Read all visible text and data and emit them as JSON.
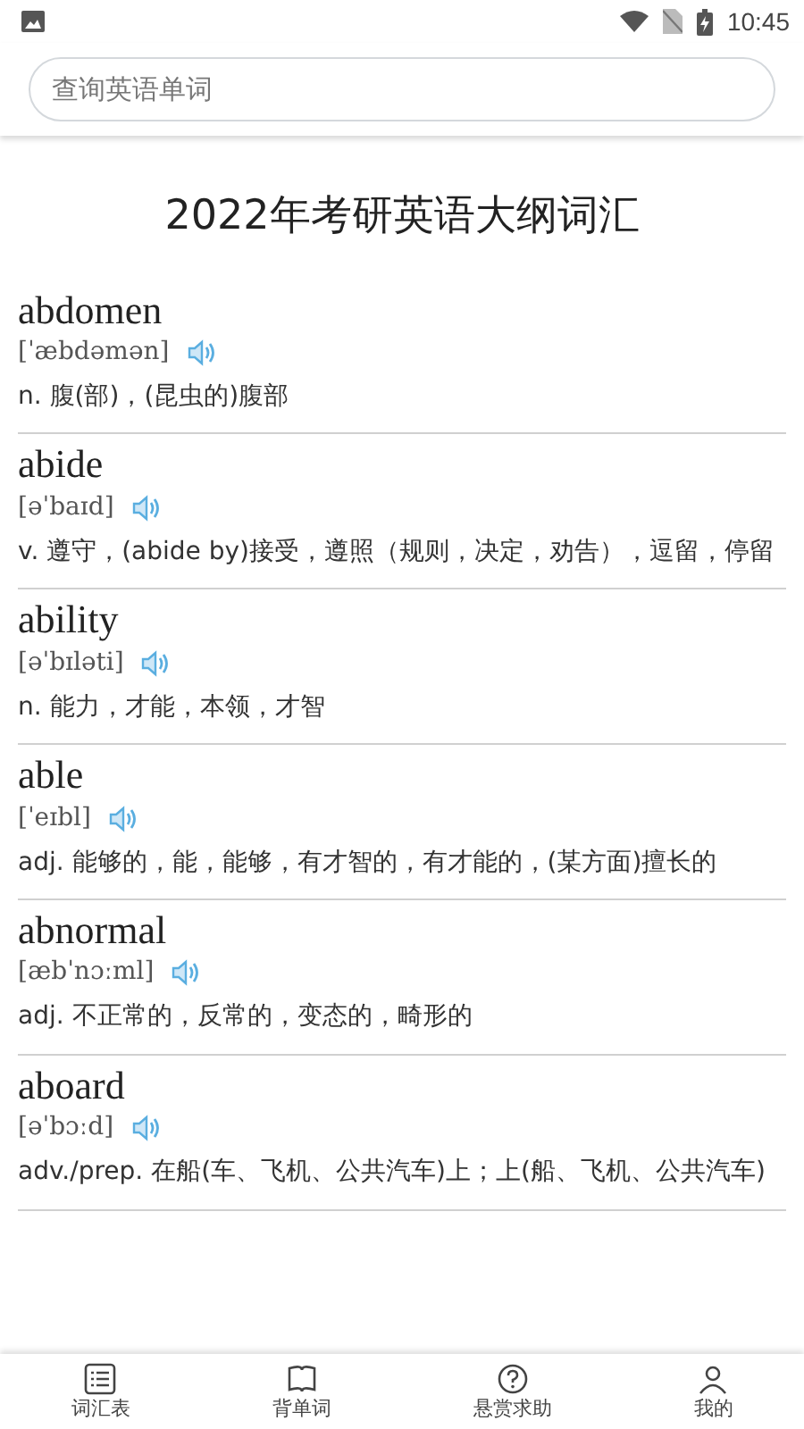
{
  "status_bar": {
    "time": "10:45"
  },
  "search": {
    "placeholder": "查询英语单词"
  },
  "title": "2022年考研英语大纲词汇",
  "entries": [
    {
      "word": "abdomen",
      "phonetic": "[ˈæbdəmən]",
      "definition": "n. 腹(部)，(昆虫的)腹部"
    },
    {
      "word": "abide",
      "phonetic": "[əˈbaɪd]",
      "definition": "v. 遵守，(abide by)接受，遵照（规则，决定，劝告），逗留，停留"
    },
    {
      "word": "ability",
      "phonetic": "[əˈbɪləti]",
      "definition": "n. 能力，才能，本领，才智"
    },
    {
      "word": "able",
      "phonetic": "[ˈeɪbl]",
      "definition": "adj. 能够的，能，能够，有才智的，有才能的，(某方面)擅长的"
    },
    {
      "word": "abnormal",
      "phonetic": "[æbˈnɔːml]",
      "definition": "adj. 不正常的，反常的，变态的，畸形的"
    },
    {
      "word": "aboard",
      "phonetic": "[əˈbɔːd]",
      "definition": "adv./prep. 在船(车、飞机、公共汽车)上；上(船、飞机、公共汽车)"
    }
  ],
  "nav": [
    {
      "label": "词汇表",
      "kind": "list"
    },
    {
      "label": "背单词",
      "kind": "book"
    },
    {
      "label": "悬赏求助",
      "kind": "help"
    },
    {
      "label": "我的",
      "kind": "user"
    }
  ]
}
